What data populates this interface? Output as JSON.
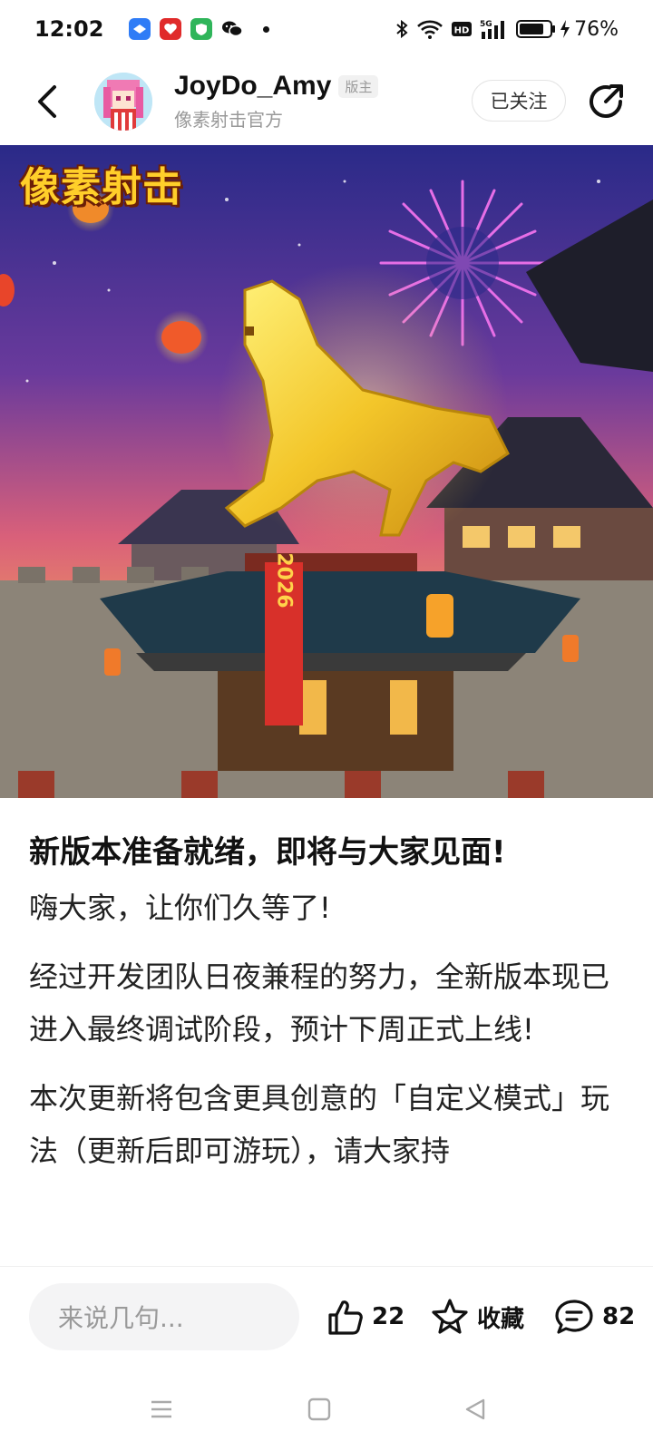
{
  "status_bar": {
    "time": "12:02",
    "battery_pct": "76%",
    "icons": [
      "bluetooth-icon",
      "wifi-icon",
      "hd-icon",
      "5g-signal-icon",
      "battery-icon",
      "charging-icon"
    ]
  },
  "header": {
    "author_name": "JoyDo_Amy",
    "badge": "版主",
    "subtitle": "像素射击官方",
    "follow_label": "已关注"
  },
  "banner": {
    "logo_text": "像素射击",
    "sign_text": "2026"
  },
  "article": {
    "title": "新版本准备就绪，即将与大家见面!",
    "paragraphs": [
      "嗨大家，让你们久等了!",
      "经过开发团队日夜兼程的努力，全新版本现已进入最终调试阶段，预计下周正式上线!",
      "本次更新将包含更具创意的「自定义模式」玩法（更新后即可游玩），请大家持"
    ]
  },
  "action_bar": {
    "comment_placeholder": "来说几句...",
    "like_count": "22",
    "favorite_label": "收藏",
    "comment_count": "82"
  },
  "colors": {
    "accent_gold": "#ffcf2a",
    "text_primary": "#111111",
    "text_secondary": "#999999"
  }
}
